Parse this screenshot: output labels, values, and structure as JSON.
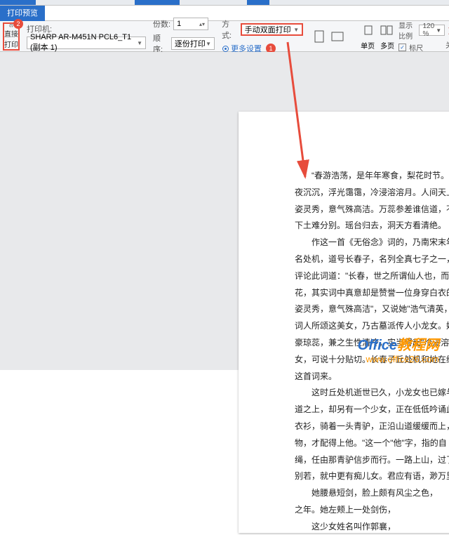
{
  "tabbar": {
    "active": "打印预览"
  },
  "toolbar": {
    "direct_print": "直接打印",
    "printer_label": "打印机:",
    "printer_value": "SHARP AR-M451N PCL6_T1 (副本 1)",
    "copies_label": "份数:",
    "copies_value": "1",
    "order_label": "顺序:",
    "order_value": "逐份打印",
    "mode_label": "方式:",
    "mode_value": "手动双面打印",
    "more_settings": "更多设置",
    "zoom_label": "显示比例",
    "zoom_value": "120 %",
    "single_page": "单页",
    "multi_page": "多页",
    "ruler": "标尺",
    "close": "关闭",
    "badge1": "1",
    "badge2": "2"
  },
  "doc": {
    "p1": "“春游浩荡，是年年寒食，梨花时节。白",
    "p2": "夜沉沉，浮光霭霭，冷浸溶溶月。人间天上，",
    "p3": "姿灵秀，意气殊高洁。万蕊参差谁信道，不与",
    "p4": "下土难分别。瑶台归去，洞天方看清绝。",
    "p5": "作这一首《无俗念》词的，乃南宋末年一",
    "p6": "名处机，道号长春子，名列全真七子之一，是",
    "p7": "评论此词道：\"长春，世之所谓仙人也，而词",
    "p8": "花，其实词中真意却是赞誉一位身穿白衣的美",
    "p9": "姿灵秀，意气殊高洁\"，又说她\"浩气清英，",
    "p10": "词人所颂这美女，乃古墓派传人小龙女。她一",
    "p11": "豪琼蕊，兼之生性清冷，实当得起\"冷浸溶溶",
    "p12": "女，可说十分贴切。长春子丘处机和她在终南",
    "p13": "这首词来。",
    "p14": "这时丘处机逝世已久，小龙女也已嫁与神",
    "p15": "道之上，却另有一个少女，正在低低吟诵此词",
    "p16": "衣衫，骑着一头青驴，正沿山道缓缓而上，心",
    "p17": "物，才配得上他。\"这一个\"他\"字，指的自",
    "p18": "绳，任由那青驴信步而行。一路上山，过了",
    "p19": "别若，就中更有痴儿女。君应有语，渺万里层",
    "p20": "她腰悬短剑，脸上颇有风尘之色，",
    "p21": "之年。她左颊上一处剑伤，",
    "p22": "这少女姓名叫作郭襄，"
  },
  "watermark": {
    "brand1": "Office",
    "brand2": "教程网",
    "url": "www.office26.com"
  }
}
